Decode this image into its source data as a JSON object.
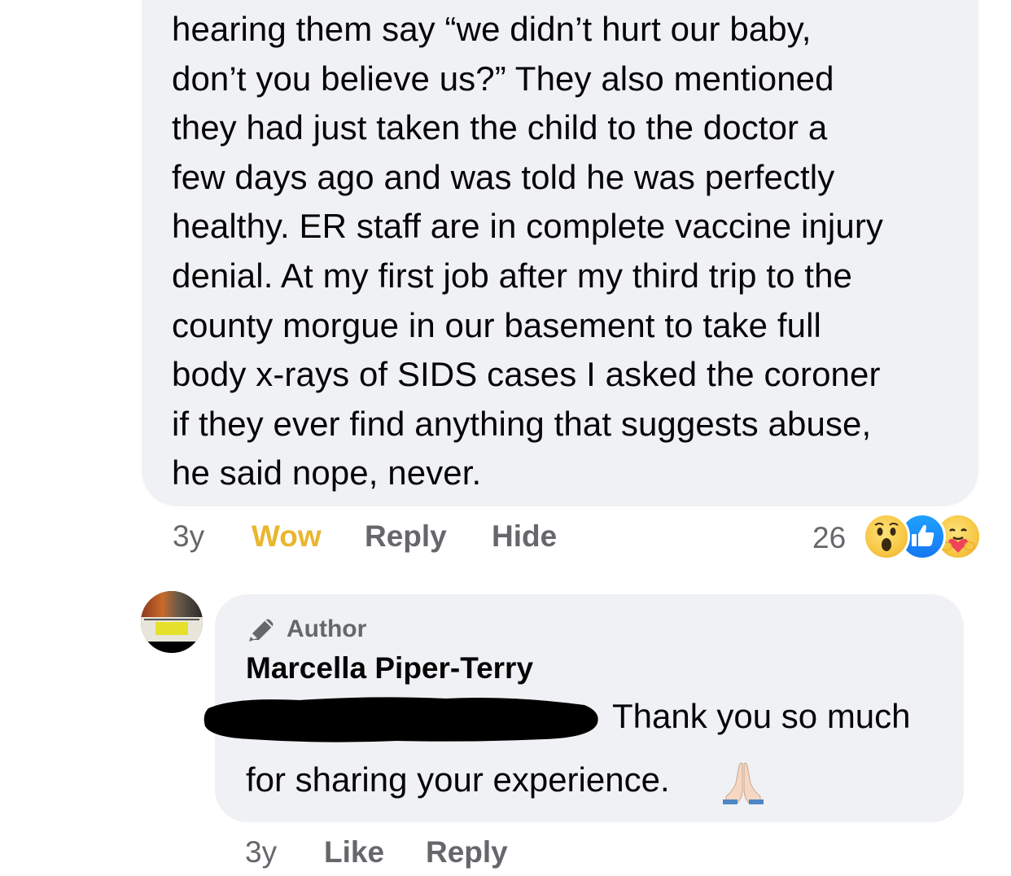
{
  "comment_1": {
    "lines": [
      "hearing them say “we didn’t hurt our baby,",
      "don’t you believe us?” They also mentioned",
      "they had just taken the child to the doctor a",
      "few days ago and was told he was perfectly",
      "healthy. ER staff are in complete vaccine injury",
      "denial. At my first job after my third trip to the",
      "county morgue in our basement to take full",
      "body x-rays of SIDS cases I asked the coroner",
      "if they ever find anything that suggests abuse,",
      "he said nope, never."
    ],
    "actions": {
      "age": "3y",
      "reaction_label": "Wow",
      "reply_label": "Reply",
      "hide_label": "Hide"
    },
    "reaction_count": "26",
    "reaction_icons": [
      "wow-reaction-icon",
      "like-reaction-icon",
      "care-reaction-icon"
    ]
  },
  "comment_2": {
    "badge_icon": "pencil-icon",
    "badge_label": "Author",
    "author_name": "Marcella Piper-Terry",
    "text_line_1": "Thank you so much",
    "text_line_2": "for sharing your experience.",
    "emoji": "folded-hands-icon",
    "actions": {
      "age": "3y",
      "like_label": "Like",
      "reply_label": "Reply"
    }
  },
  "colors": {
    "bubble": "#f0f1f4",
    "text": "#050505",
    "secondary": "#65676b",
    "wow_accent": "#e9b62f",
    "like_blue": "#1677f2"
  }
}
